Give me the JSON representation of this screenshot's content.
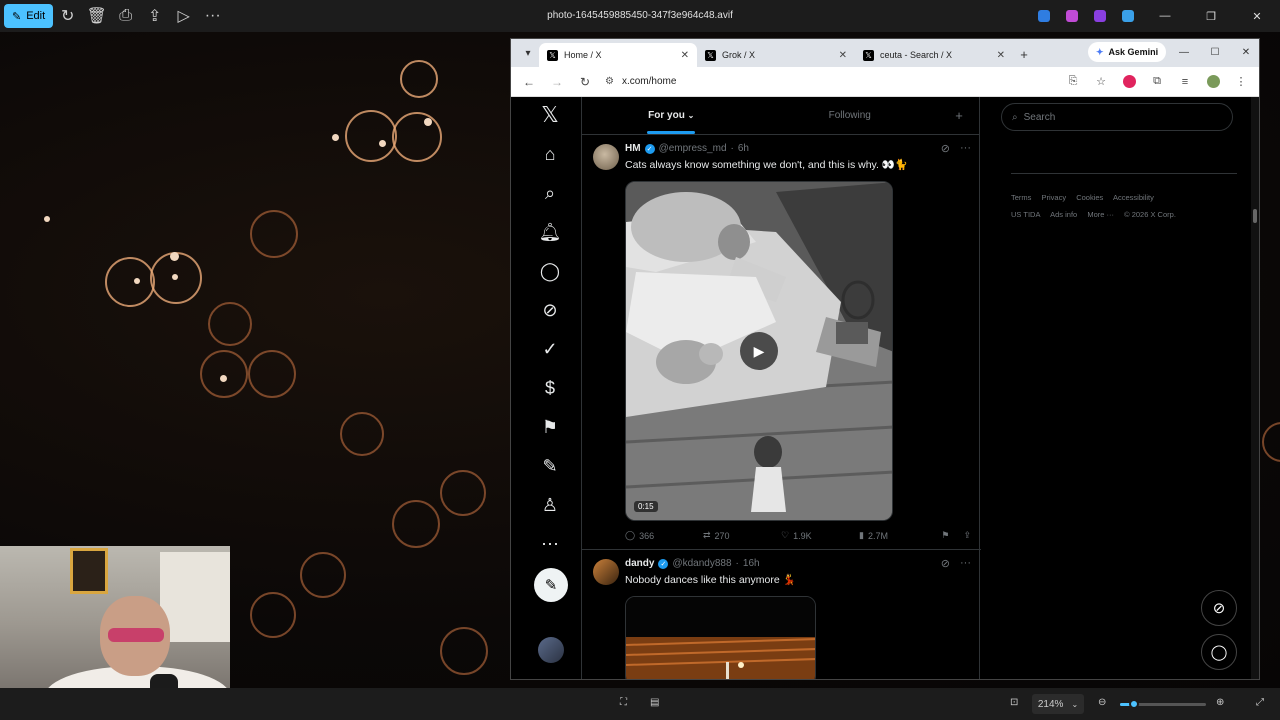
{
  "viewer": {
    "edit_label": "Edit",
    "title": "photo-1645459885450-347f3e964c48.avif",
    "zoom": "214%",
    "zoom_level": 0.16
  },
  "browser": {
    "tabs": [
      {
        "title": "Home / X",
        "active": true
      },
      {
        "title": "Grok / X",
        "active": false
      },
      {
        "title": "ceuta - Search / X",
        "active": false
      }
    ],
    "ask_gemini": "Ask Gemini",
    "url": "x.com/home"
  },
  "x": {
    "feed_tabs": [
      "For you",
      "Following"
    ],
    "tweets": [
      {
        "name": "HM",
        "handle": "@empress_md",
        "time": "6h",
        "text": "Cats always know something we don't, and this is why. 👀🐈",
        "duration": "0:15",
        "replies": "366",
        "reposts": "270",
        "likes": "1.9K",
        "views": "2.7M"
      },
      {
        "name": "dandy",
        "handle": "@kdandy888",
        "time": "16h",
        "text": "Nobody dances like this anymore 💃"
      }
    ],
    "search_placeholder": "Search",
    "footer_links": [
      "Terms",
      "Privacy",
      "Cookies",
      "Accessibility",
      "US TIDA",
      "Ads info",
      "More ···",
      "© 2026 X Corp."
    ]
  },
  "colors": {
    "accent": "#1d9bf0",
    "edit_button": "#4cc2ff"
  }
}
